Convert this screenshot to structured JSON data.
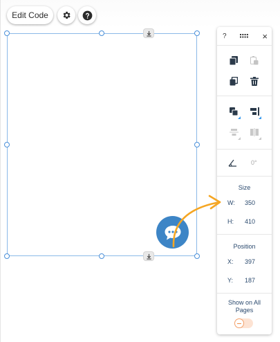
{
  "toolbar": {
    "edit_code_label": "Edit Code",
    "settings_icon": "gear-icon",
    "help_icon": "question-icon"
  },
  "panel": {
    "header": {
      "help_label": "?",
      "drag_icon": "drag-handle-icon",
      "close_label": "×"
    },
    "actions": {
      "copy_icon": "copy-icon",
      "paste_icon": "paste-icon",
      "duplicate_icon": "duplicate-icon",
      "delete_icon": "trash-icon",
      "arrange_icon": "arrange-icon",
      "align_icon": "align-icon",
      "distribute_icon": "distribute-icon",
      "match_size_icon": "match-size-icon",
      "rotate_icon": "rotate-angle-icon",
      "rotation_value": "0°"
    },
    "size": {
      "title": "Size",
      "width_label": "W:",
      "width_value": "350",
      "height_label": "H:",
      "height_value": "410"
    },
    "position": {
      "title": "Position",
      "x_label": "X:",
      "x_value": "397",
      "y_label": "Y:",
      "y_value": "187"
    },
    "show_on_all_pages": {
      "label_line1": "Show on All",
      "label_line2": "Pages",
      "enabled": false
    }
  },
  "canvas": {
    "chat_icon": "chat-bubble-icon",
    "stretch_icon": "stretch-down-icon"
  },
  "colors": {
    "selection_border": "#8ab9e8",
    "accent_blue": "#3899ec",
    "chat_blue": "#3d85c6",
    "arrow_orange": "#f5a623",
    "label_text": "#2b4a6e"
  }
}
